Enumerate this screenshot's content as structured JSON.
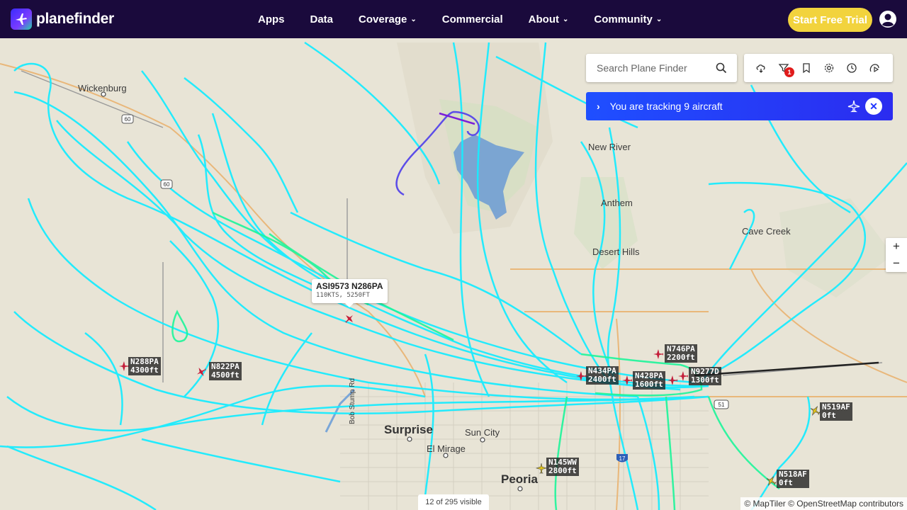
{
  "brand": {
    "name": "planefinder"
  },
  "nav": [
    {
      "label": "Apps",
      "has_menu": false
    },
    {
      "label": "Data",
      "has_menu": false
    },
    {
      "label": "Coverage",
      "has_menu": true
    },
    {
      "label": "Commercial",
      "has_menu": false
    },
    {
      "label": "About",
      "has_menu": true
    },
    {
      "label": "Community",
      "has_menu": true
    }
  ],
  "trial_button": "Start Free Trial",
  "search": {
    "placeholder": "Search Plane Finder"
  },
  "toolbar": {
    "filter_badge": "1",
    "icons": [
      "weather-icon",
      "filter-icon",
      "bookmark-icon",
      "settings-icon",
      "history-icon",
      "playback-icon"
    ]
  },
  "tracking": {
    "text": "You are tracking 9 aircraft"
  },
  "zoom": {
    "in": "+",
    "out": "−"
  },
  "places": [
    {
      "name": "Wickenburg",
      "size": "mid"
    },
    {
      "name": "New River",
      "size": "mid"
    },
    {
      "name": "Anthem",
      "size": "mid"
    },
    {
      "name": "Desert Hills",
      "size": "mid"
    },
    {
      "name": "Cave Creek",
      "size": "mid"
    },
    {
      "name": "Surprise",
      "size": "big"
    },
    {
      "name": "Sun City",
      "size": "mid"
    },
    {
      "name": "El Mirage",
      "size": "mid"
    },
    {
      "name": "Peoria",
      "size": "big"
    },
    {
      "name": "Bob Stump Rd",
      "size": "small"
    }
  ],
  "popup": {
    "title": "ASI9573 N286PA",
    "detail": "110KTS, 5250FT"
  },
  "aircraft": [
    {
      "callsign": "N288PA",
      "alt": "4300ft",
      "color": "#c41f3b"
    },
    {
      "callsign": "N822PA",
      "alt": "4500ft",
      "color": "#c41f3b"
    },
    {
      "callsign": "N746PA",
      "alt": "2200ft",
      "color": "#c41f3b"
    },
    {
      "callsign": "N434PA",
      "alt": "2400ft",
      "color": "#c41f3b"
    },
    {
      "callsign": "N428PA",
      "alt": "1600ft",
      "color": "#c41f3b"
    },
    {
      "callsign": "N9277D",
      "alt": "1300ft",
      "color": "#c41f3b"
    },
    {
      "callsign": "N519AF",
      "alt": "0ft",
      "color": "#e0c21a"
    },
    {
      "callsign": "N518AF",
      "alt": "0ft",
      "color": "#e0c21a"
    },
    {
      "callsign": "N145WW",
      "alt": "2800ft",
      "color": "#e0c21a"
    }
  ],
  "visible_count": "12 of 295 visible",
  "attribution": "© MapTiler © OpenStreetMap contributors",
  "route_shields": [
    "60",
    "60",
    "51",
    "17"
  ],
  "colors": {
    "nav_bg": "#1a0a3c",
    "trial": "#f2d33d",
    "track_cyan": "#00eaff",
    "track_green": "#00f58a",
    "tracking_bar": "#1f4fff"
  }
}
